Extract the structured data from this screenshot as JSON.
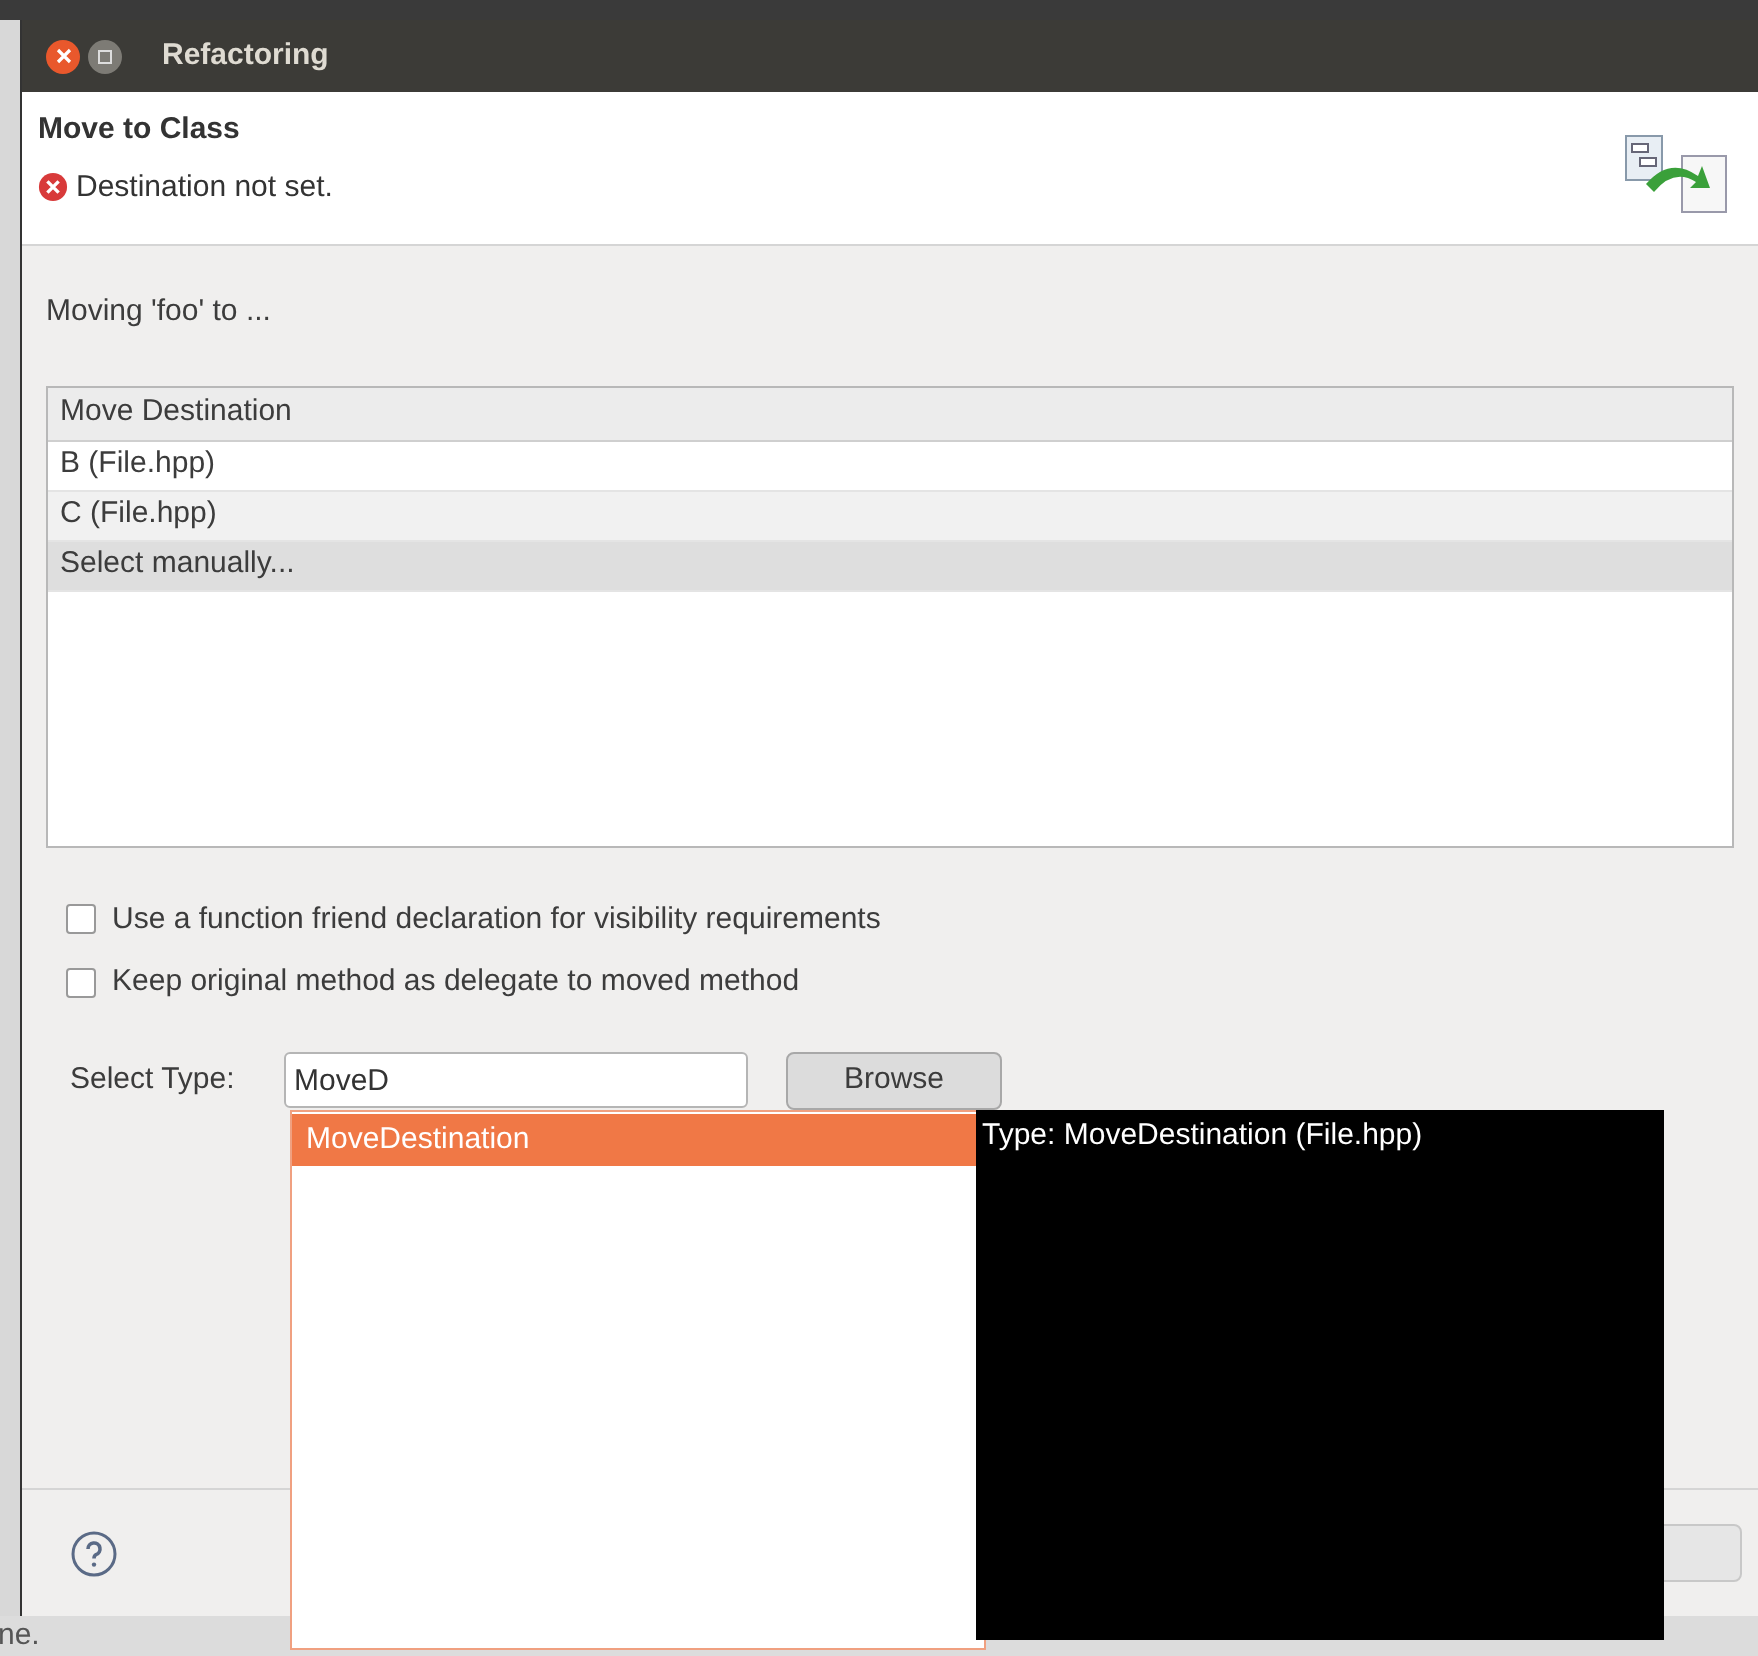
{
  "window": {
    "title": "Refactoring"
  },
  "header": {
    "title": "Move to Class",
    "message": "Destination not set."
  },
  "prompt": "Moving 'foo' to ...",
  "table": {
    "columns": [
      "Move Destination"
    ],
    "rows": [
      {
        "label": "B (File.hpp)",
        "selected": false
      },
      {
        "label": "C (File.hpp)",
        "selected": false
      },
      {
        "label": "Select manually...",
        "selected": true
      }
    ]
  },
  "options": [
    {
      "label": "Use a function friend declaration for visibility requirements",
      "checked": false
    },
    {
      "label": "Keep original method as delegate to moved method",
      "checked": false
    }
  ],
  "select_type": {
    "label": "Select Type:",
    "value": "MoveD",
    "button": "Browse"
  },
  "completion": {
    "items": [
      {
        "label": "MoveDestination",
        "selected": true
      }
    ],
    "tooltip": "Type: MoveDestination (File.hpp)"
  },
  "background_text": "ne."
}
